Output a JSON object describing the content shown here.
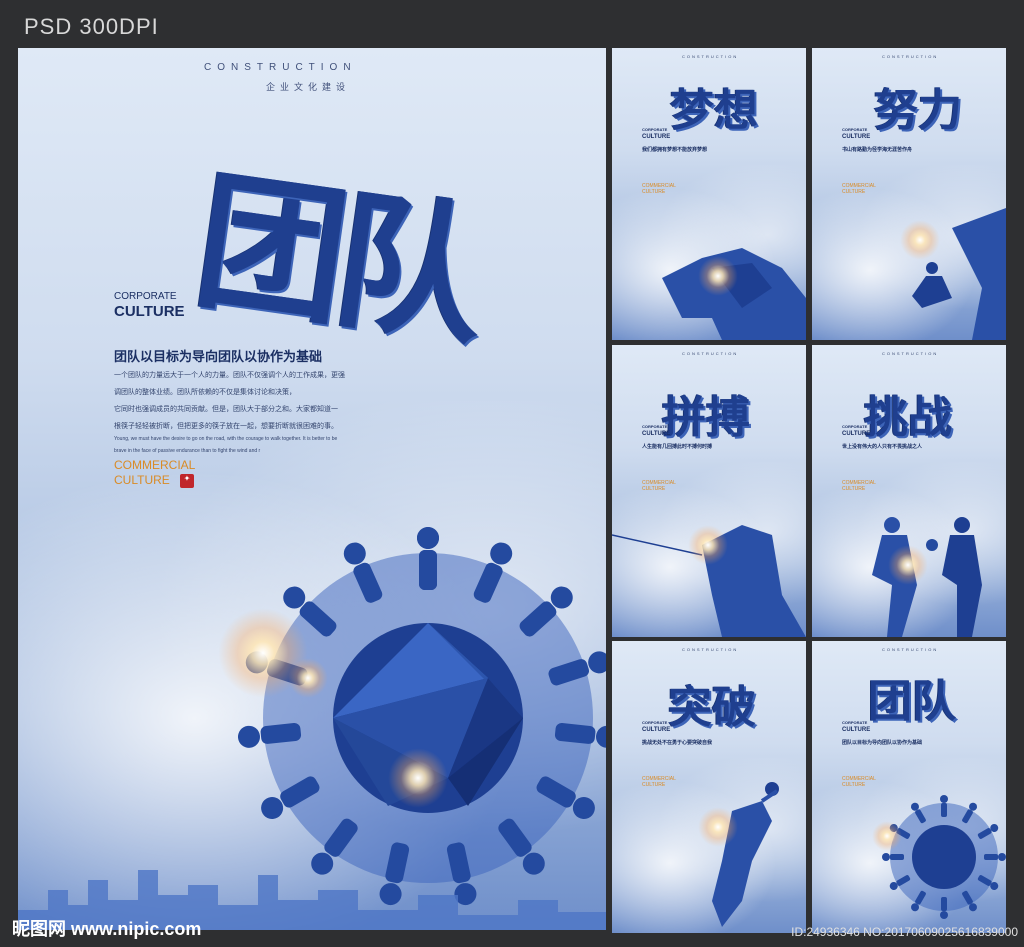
{
  "header": {
    "label": "PSD  300DPI"
  },
  "main_poster": {
    "construction": "CONSTRUCTION",
    "subtitle_cn": "企业文化建设",
    "title": "团队",
    "corporate": "CORPORATE",
    "culture": "CULTURE",
    "headline": "团队以目标为导向团队以协作为基础",
    "para": [
      "一个团队的力量远大于一个人的力量。团队不仅强调个人的工作成果，更强",
      "调团队的整体业绩。团队所依赖的不仅是集体讨论和决策，",
      "它同时也强调成员的共同贡献。但是，团队大于部分之和。大家都知道一",
      "根筷子轻轻被折断，但把更多的筷子放在一起，想要折断就很困难的事。"
    ],
    "en_lines": [
      "Young, we must have the desire to go on the road, with the courage to walk together. It is better to be",
      "brave in the face of passive endurance than to fight the wind and r"
    ],
    "commercial": "COMMERCIAL",
    "culture2": "CULTURE"
  },
  "posters": [
    {
      "title": "梦想",
      "headline": "我们都拥有梦想不能放弃梦想"
    },
    {
      "title": "努力",
      "headline": "书山有路勤为径学海无涯苦作舟"
    },
    {
      "title": "拼搏",
      "headline": "人生能有几回搏此时不搏何时搏"
    },
    {
      "title": "挑战",
      "headline": "世上没有伟大的人只有不畏挑战之人"
    },
    {
      "title": "突破",
      "headline": "挑战无处不在勇于心要突破自我"
    },
    {
      "title": "团队",
      "headline": "团队以目标为导向团队以协作为基础"
    }
  ],
  "small_labels": {
    "construction": "CONSTRUCTION",
    "corporate": "CORPORATE",
    "culture": "CULTURE",
    "commercial": "COMMERCIAL",
    "culture2": "CULTURE"
  },
  "footer": {
    "logo": "昵图网 www.nipic.com",
    "id": "ID:24936346 NO:20170609025616839000"
  },
  "colors": {
    "accent_blue": "#1f3f8f",
    "orange": "#d98b26",
    "background": "#2e2f31"
  }
}
